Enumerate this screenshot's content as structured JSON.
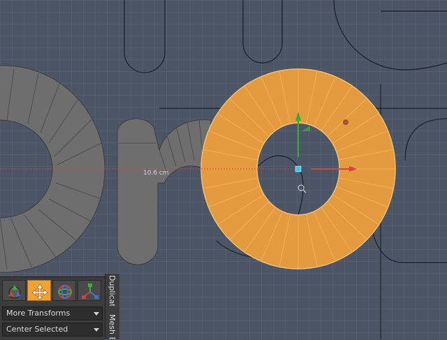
{
  "viewport": {
    "measure_label": "10.6 cm"
  },
  "toolbar": {
    "buttons": [
      {
        "name": "transform-tool",
        "icon": "transform-icon",
        "active": false
      },
      {
        "name": "move-tool",
        "icon": "move-icon",
        "active": true
      },
      {
        "name": "rotate-tool",
        "icon": "rotate-icon",
        "active": false
      },
      {
        "name": "scale-tool",
        "icon": "scale-icon",
        "active": false
      }
    ],
    "more_transforms": "More Transforms",
    "center_selected": "Center Selected"
  },
  "side_tabs": {
    "duplicate": "Duplicate",
    "mesh_edit": "Mesh E"
  },
  "colors": {
    "background": "#4b5566",
    "selection": "#e49a3e",
    "x_axis": "#e04040",
    "y_axis": "#2fb02f"
  }
}
